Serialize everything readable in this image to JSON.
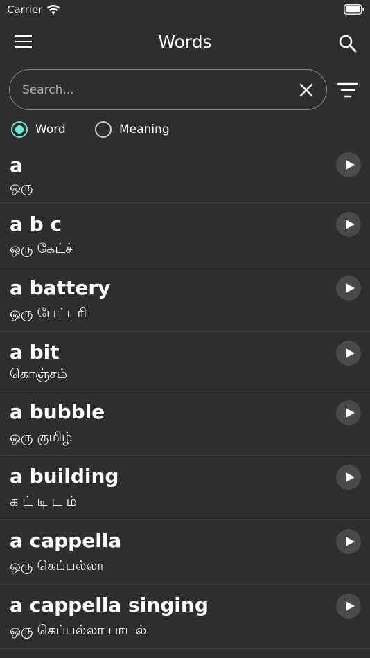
{
  "status": {
    "carrier": "Carrier"
  },
  "header": {
    "title": "Words"
  },
  "search": {
    "placeholder": "Search...",
    "value": ""
  },
  "radios": [
    {
      "label": "Word",
      "selected": true
    },
    {
      "label": "Meaning",
      "selected": false
    }
  ],
  "colors": {
    "accent": "#6fe6d3",
    "background": "#2e2e2e"
  },
  "items": [
    {
      "word": "a",
      "meaning": "ஒரு"
    },
    {
      "word": "a b c",
      "meaning": "ஒரு கேட்ச்"
    },
    {
      "word": "a battery",
      "meaning": "ஒரு பேட்டரி"
    },
    {
      "word": "a bit",
      "meaning": "கொஞ்சம்"
    },
    {
      "word": "a bubble",
      "meaning": "ஒரு குமிழ்"
    },
    {
      "word": "a building",
      "meaning": "க ட் டி ட ம்"
    },
    {
      "word": "a cappella",
      "meaning": "ஒரு கெப்பல்லா"
    },
    {
      "word": "a cappella singing",
      "meaning": "ஒரு கெப்பல்லா பாடல்"
    }
  ]
}
